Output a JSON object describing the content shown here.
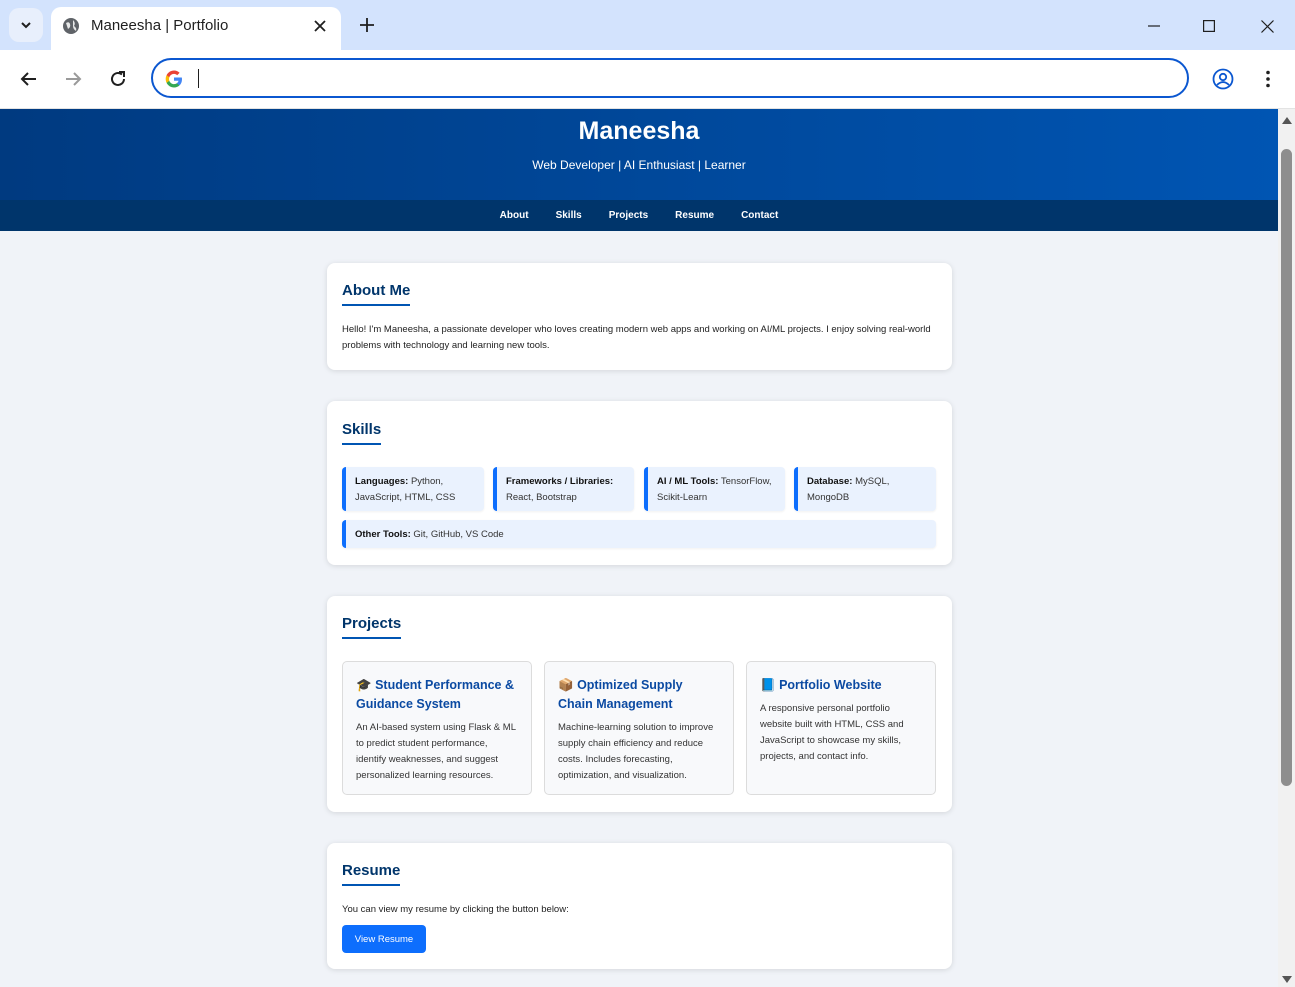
{
  "browser": {
    "tab_title": "Maneesha | Portfolio",
    "address_value": "",
    "address_placeholder": ""
  },
  "site": {
    "name": "Maneesha",
    "tagline": "Web Developer | AI Enthusiast | Learner",
    "nav": [
      "About",
      "Skills",
      "Projects",
      "Resume",
      "Contact"
    ]
  },
  "about": {
    "title": "About Me",
    "text": "Hello! I'm Maneesha, a passionate developer who loves creating modern web apps and working on AI/ML projects. I enjoy solving real-world problems with technology and learning new tools."
  },
  "skills": {
    "title": "Skills",
    "items": [
      {
        "label": "Languages:",
        "value": "Python, JavaScript, HTML, CSS"
      },
      {
        "label": "Frameworks / Libraries:",
        "value": "React, Bootstrap"
      },
      {
        "label": "AI / ML Tools:",
        "value": "TensorFlow, Scikit-Learn"
      },
      {
        "label": "Database:",
        "value": "MySQL, MongoDB"
      },
      {
        "label": "Other Tools:",
        "value": "Git, GitHub, VS Code"
      }
    ]
  },
  "projects": {
    "title": "Projects",
    "items": [
      {
        "emoji": "🎓",
        "title": "Student Performance & Guidance System",
        "desc": "An AI-based system using Flask & ML to predict student performance, identify weaknesses, and suggest personalized learning resources."
      },
      {
        "emoji": "📦",
        "title": "Optimized Supply Chain Management",
        "desc": "Machine-learning solution to improve supply chain efficiency and reduce costs. Includes forecasting, optimization, and visualization."
      },
      {
        "emoji": "📘",
        "title": "Portfolio Website",
        "desc": "A responsive personal portfolio website built with HTML, CSS and JavaScript to showcase my skills, projects, and contact info."
      }
    ]
  },
  "resume": {
    "title": "Resume",
    "text": "You can view my resume by clicking the button below:",
    "button": "View Resume"
  },
  "colors": {
    "header_start": "#003a80",
    "header_end": "#0055b3",
    "nav_bg": "#00356b",
    "accent": "#0d6efd",
    "page_bg": "#f0f3f8"
  }
}
